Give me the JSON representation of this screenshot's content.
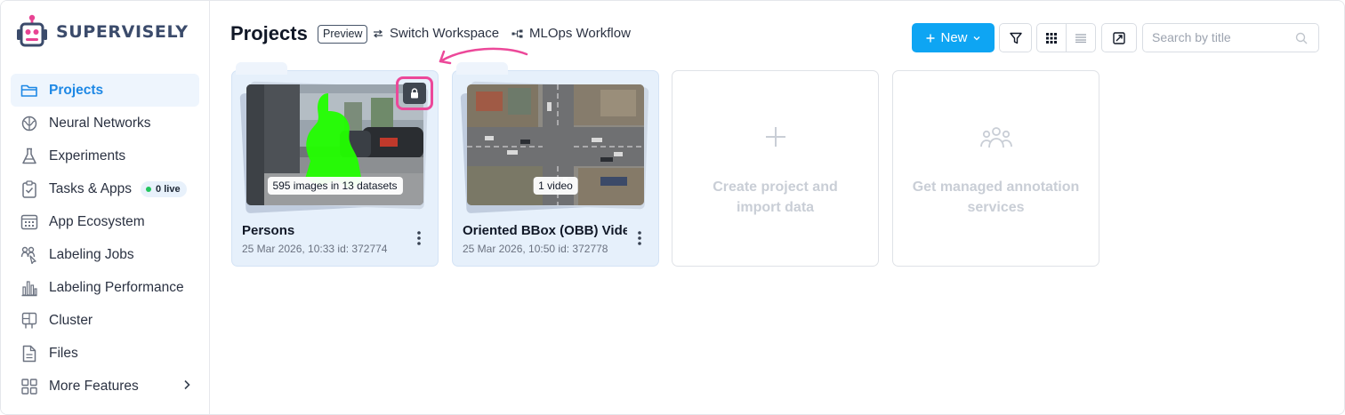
{
  "brand": {
    "name": "SUPERVISELY"
  },
  "sidebar": {
    "items": [
      {
        "label": "Projects",
        "icon": "folder-icon",
        "active": true
      },
      {
        "label": "Neural Networks",
        "icon": "brain-icon"
      },
      {
        "label": "Experiments",
        "icon": "flask-icon"
      },
      {
        "label": "Tasks & Apps",
        "icon": "clipboard-check-icon",
        "badge": "0 live"
      },
      {
        "label": "App Ecosystem",
        "icon": "app-grid-icon"
      },
      {
        "label": "Labeling Jobs",
        "icon": "labeling-jobs-icon"
      },
      {
        "label": "Labeling Performance",
        "icon": "bar-chart-icon"
      },
      {
        "label": "Cluster",
        "icon": "cluster-icon"
      },
      {
        "label": "Files",
        "icon": "file-icon"
      },
      {
        "label": "More Features",
        "icon": "grid-icon"
      }
    ]
  },
  "header": {
    "title": "Projects",
    "preview_tag": "Preview",
    "switch_workspace": "Switch Workspace",
    "mlops_workflow": "MLOps Workflow",
    "new_button": "New",
    "search_placeholder": "Search by title"
  },
  "projects": [
    {
      "title": "Persons",
      "meta": "25 Mar 2026, 10:33  id: 372774",
      "thumb_label": "595 images in 13 datasets",
      "locked": true
    },
    {
      "title": "Oriented BBox (OBB) Vide",
      "meta": "25 Mar 2026, 10:50  id: 372778",
      "thumb_label": "1 video",
      "locked": false
    }
  ],
  "actions": [
    {
      "label_line1": "Create project and",
      "label_line2": "import data",
      "icon": "plus-icon"
    },
    {
      "label_line1": "Get managed annotation",
      "label_line2": "services",
      "icon": "team-icon"
    }
  ],
  "colors": {
    "accent": "#0ea5f3",
    "active_nav_text": "#1e88e5",
    "highlight": "#ec4899",
    "segmentation_mask": "#22ff00"
  }
}
